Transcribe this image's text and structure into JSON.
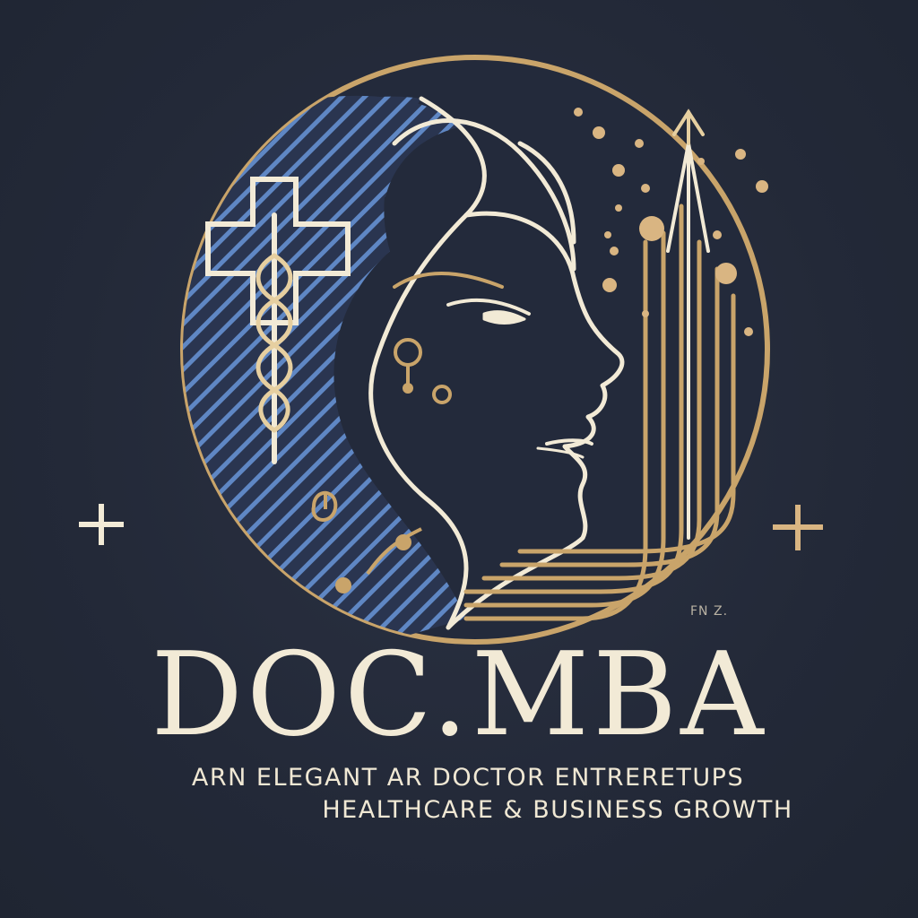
{
  "logo": {
    "wordmark": "DOC.MBA",
    "tagline_line1": "ARN ELEGANT AR DOCTOR ENTRERETUPS",
    "tagline_line2": "HEALTHCARE & BUSINESS GROWTH",
    "artist_mark": "FN Z."
  },
  "colors": {
    "background": "#252b3a",
    "gold": "#c9a46a",
    "cream": "#f2ead6",
    "blue_hatch": "#5f87c4",
    "text": "#f0e8d4"
  },
  "icons": [
    "medical-cross-icon",
    "caduceus-icon",
    "profile-head-icon",
    "growth-arrow-icon",
    "plus-sparkle-icon"
  ]
}
